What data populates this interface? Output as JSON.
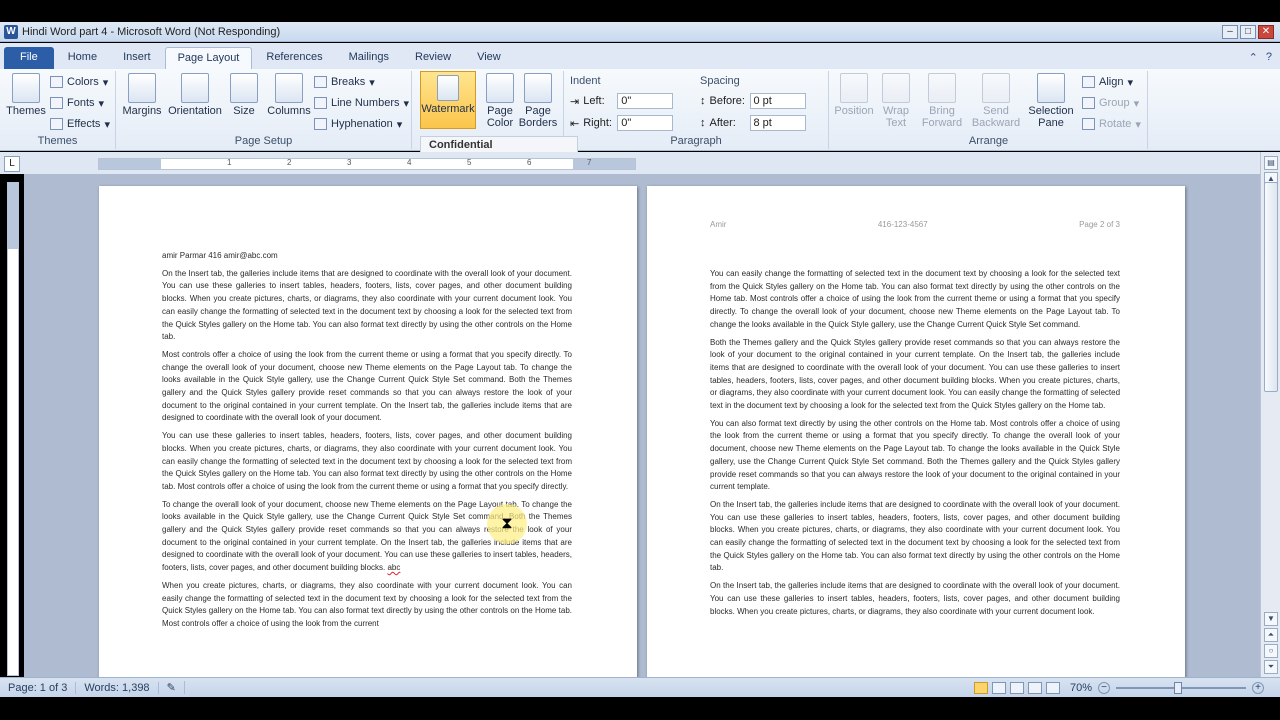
{
  "window": {
    "title": "Hindi Word part 4 - Microsoft Word (Not Responding)"
  },
  "tabs": [
    "File",
    "Home",
    "Insert",
    "Page Layout",
    "References",
    "Mailings",
    "Review",
    "View"
  ],
  "ribbon": {
    "themes": {
      "label": "Themes",
      "group": "Themes",
      "colors": "Colors",
      "fonts": "Fonts",
      "effects": "Effects"
    },
    "page_setup": {
      "group": "Page Setup",
      "margins": "Margins",
      "orientation": "Orientation",
      "size": "Size",
      "columns": "Columns",
      "breaks": "Breaks",
      "line_numbers": "Line Numbers",
      "hyphenation": "Hyphenation"
    },
    "page_background": {
      "watermark": "Watermark",
      "page_color": "Page Color",
      "page_borders": "Page Borders"
    },
    "paragraph": {
      "group": "Paragraph",
      "indent": "Indent",
      "left_label": "Left:",
      "left_value": "0\"",
      "right_label": "Right:",
      "right_value": "0\"",
      "spacing": "Spacing",
      "before_label": "Before:",
      "before_value": "0 pt",
      "after_label": "After:",
      "after_value": "8 pt"
    },
    "arrange": {
      "group": "Arrange",
      "position": "Position",
      "wrap_text": "Wrap Text",
      "bring_forward": "Bring Forward",
      "send_backward": "Send Backward",
      "selection_pane": "Selection Pane",
      "align": "Align",
      "group_btn": "Group",
      "rotate": "Rotate"
    }
  },
  "watermark_dropdown": "Confidential",
  "ruler": {
    "numbers": [
      "1",
      "2",
      "3",
      "4",
      "5",
      "6",
      "7"
    ]
  },
  "page1": {
    "first_line": "amir Parmar 416 amir@abc.com",
    "paragraphs": [
      "On the Insert tab, the galleries include items that are designed to coordinate with the overall look of your document. You can use these galleries to insert tables, headers, footers, lists, cover pages, and other document building blocks. When you create pictures, charts, or diagrams, they also coordinate with your current document look. You can easily change the formatting of selected text in the document text by choosing a look for the selected text from the Quick Styles gallery on the Home tab. You can also format text directly by using the other controls on the Home tab.",
      "Most controls offer a choice of using the look from the current theme or using a format that you specify directly. To change the overall look of your document, choose new Theme elements on the Page Layout tab. To change the looks available in the Quick Style gallery, use the Change Current Quick Style Set command. Both the Themes gallery and the Quick Styles gallery provide reset commands so that you can always restore the look of your document to the original contained in your current template. On the Insert tab, the galleries include items that are designed to coordinate with the overall look of your document.",
      "You can use these galleries to insert tables, headers, footers, lists, cover pages, and other document building blocks. When you create pictures, charts, or diagrams, they also coordinate with your current document look. You can easily change the formatting of selected text in the document text by choosing a look for the selected text from the Quick Styles gallery on the Home tab. You can also format text directly by using the other controls on the Home tab. Most controls offer a choice of using the look from the current theme or using a format that you specify directly.",
      "To change the overall look of your document, choose new Theme elements on the Page Layout tab. To change the looks available in the Quick Style gallery, use the Change Current Quick Style Set command. Both the Themes gallery and the Quick Styles gallery provide reset commands so that you can always restore the look of your document to the original contained in your current template. On the Insert tab, the galleries include items that are designed to coordinate with the overall look of your document. You can use these galleries to insert tables, headers, footers, lists, cover pages, and other document building blocks.",
      "When you create pictures, charts, or diagrams, they also coordinate with your current document look. You can easily change the formatting of selected text in the document text by choosing a look for the selected text from the Quick Styles gallery on the Home tab. You can also format text directly by using the other controls on the Home tab. Most controls offer a choice of using the look from the current"
    ],
    "misspelled": "abc"
  },
  "page2": {
    "header_left": "Amir",
    "header_center": "416-123-4567",
    "header_right": "Page 2 of 3",
    "paragraphs": [
      "You can easily change the formatting of selected text in the document text by choosing a look for the selected text from the Quick Styles gallery on the Home tab. You can also format text directly by using the other controls on the Home tab. Most controls offer a choice of using the look from the current theme or using a format that you specify directly. To change the overall look of your document, choose new Theme elements on the Page Layout tab. To change the looks available in the Quick Style gallery, use the Change Current Quick Style Set command.",
      "Both the Themes gallery and the Quick Styles gallery provide reset commands so that you can always restore the look of your document to the original contained in your current template. On the Insert tab, the galleries include items that are designed to coordinate with the overall look of your document. You can use these galleries to insert tables, headers, footers, lists, cover pages, and other document building blocks. When you create pictures, charts, or diagrams, they also coordinate with your current document look. You can easily change the formatting of selected text in the document text by choosing a look for the selected text from the Quick Styles gallery on the Home tab.",
      "You can also format text directly by using the other controls on the Home tab. Most controls offer a choice of using the look from the current theme or using a format that you specify directly. To change the overall look of your document, choose new Theme elements on the Page Layout tab. To change the looks available in the Quick Style gallery, use the Change Current Quick Style Set command. Both the Themes gallery and the Quick Styles gallery provide reset commands so that you can always restore the look of your document to the original contained in your current template.",
      "On the Insert tab, the galleries include items that are designed to coordinate with the overall look of your document. You can use these galleries to insert tables, headers, footers, lists, cover pages, and other document building blocks. When you create pictures, charts, or diagrams, they also coordinate with your current document look. You can easily change the formatting of selected text in the document text by choosing a look for the selected text from the Quick Styles gallery on the Home tab. You can also format text directly by using the other controls on the Home tab.",
      "On the Insert tab, the galleries include items that are designed to coordinate with the overall look of your document. You can use these galleries to insert tables, headers, footers, lists, cover pages, and other document building blocks. When you create pictures, charts, or diagrams, they also coordinate with your current document look."
    ]
  },
  "status": {
    "page": "Page: 1 of 3",
    "words": "Words: 1,398",
    "zoom": "70%"
  },
  "colors": {
    "accent": "#2b5ea7",
    "highlight": "#fbc54b"
  }
}
